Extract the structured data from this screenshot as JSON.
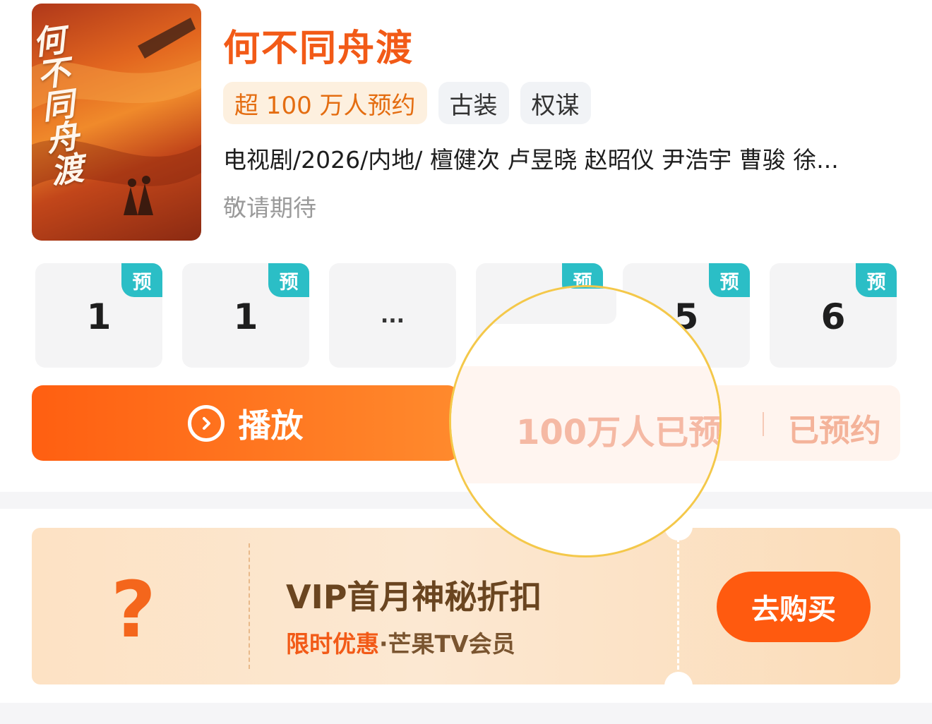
{
  "show": {
    "title": "何不同舟渡",
    "poster_text": "何\n不同\n舟渡",
    "tags": [
      "超 100 万人预约",
      "古装",
      "权谋"
    ],
    "meta": "电视剧/2026/内地/ 檀健次 卢昱晓 赵昭仪 尹浩宇 曹骏 徐...",
    "status": "敬请期待"
  },
  "episodes": [
    {
      "label": "1",
      "badge": "预"
    },
    {
      "label": "1",
      "badge": "预"
    },
    {
      "label": "...",
      "badge": ""
    },
    {
      "label": "",
      "badge": "预"
    },
    {
      "label": "5",
      "badge": "预"
    },
    {
      "label": "6",
      "badge": "预"
    }
  ],
  "actions": {
    "play_label": "播放",
    "reserve_count": "100万人已预",
    "reserve_done": "已预约"
  },
  "vip": {
    "icon": "?",
    "title": "VIP首月神秘折扣",
    "sub_accent": "限时优惠",
    "sub_rest": "·芒果TV会员",
    "buy_label": "去购买"
  },
  "colors": {
    "brand_orange": "#f25a17",
    "badge_teal": "#2bbec6",
    "lens_border": "#f4c84a"
  }
}
